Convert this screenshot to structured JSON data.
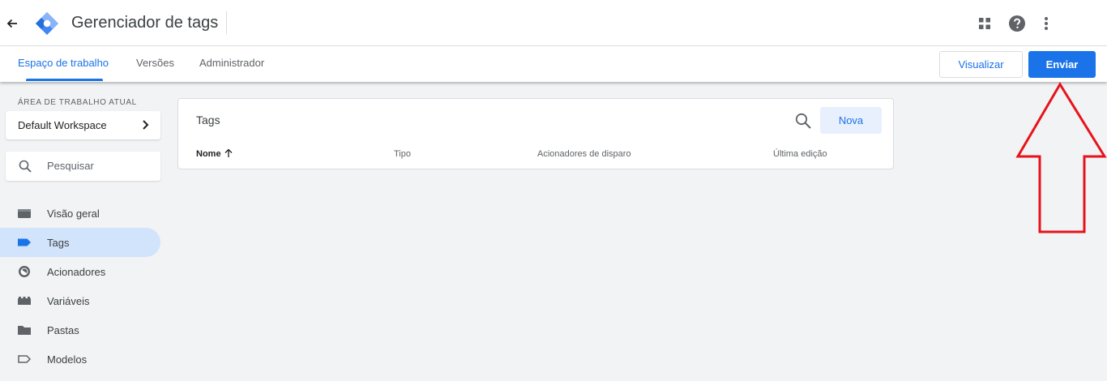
{
  "header": {
    "back_icon": "arrow-back-icon",
    "app_title": "Gerenciador de tags",
    "logo": "gtm-diamond-logo",
    "apps_icon": "apps-grid-icon",
    "help_icon": "help-circle-icon",
    "more_icon": "more-vert-icon"
  },
  "nav": {
    "tabs": [
      {
        "label": "Espaço de trabalho",
        "active": true
      },
      {
        "label": "Versões",
        "active": false
      },
      {
        "label": "Administrador",
        "active": false
      }
    ],
    "preview_label": "Visualizar",
    "submit_label": "Enviar"
  },
  "sidebar": {
    "workspace_label": "ÁREA DE TRABALHO ATUAL",
    "workspace_name": "Default Workspace",
    "search_placeholder": "Pesquisar",
    "items": [
      {
        "label": "Visão geral",
        "icon": "overview-folder-icon",
        "active": false
      },
      {
        "label": "Tags",
        "icon": "tag-icon",
        "active": true
      },
      {
        "label": "Acionadores",
        "icon": "trigger-icon",
        "active": false
      },
      {
        "label": "Variáveis",
        "icon": "variables-icon",
        "active": false
      },
      {
        "label": "Pastas",
        "icon": "folder-icon",
        "active": false
      },
      {
        "label": "Modelos",
        "icon": "template-tag-icon",
        "active": false
      }
    ]
  },
  "tags_card": {
    "title": "Tags",
    "new_label": "Nova",
    "columns": [
      "Nome",
      "Tipo",
      "Acionadores de disparo",
      "Última edição"
    ],
    "sort_column": "Nome",
    "sort_direction": "ascending"
  },
  "colors": {
    "accent": "#1a73e8",
    "active_nav_bg": "#d2e3fc",
    "annotation_arrow": "#e8121b"
  }
}
